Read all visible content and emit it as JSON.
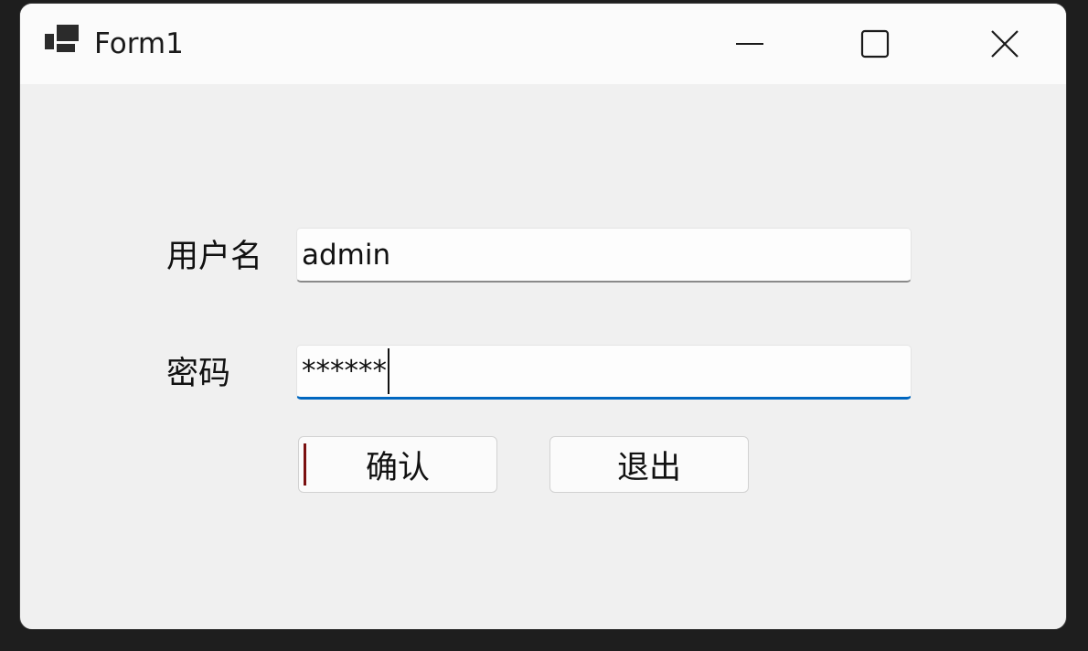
{
  "window": {
    "title": "Form1",
    "icons": {
      "app": "app-window-icon",
      "minimize": "minimize-icon",
      "maximize": "maximize-icon",
      "close": "close-icon"
    }
  },
  "form": {
    "username_label": "用户名",
    "username_value": "admin",
    "password_label": "密码",
    "password_masked": "******",
    "confirm_label": "确认",
    "exit_label": "退出"
  },
  "colors": {
    "focus_underline": "#0067c0",
    "focus_indicator": "#7a1010",
    "client_background": "#f0f0f0",
    "titlebar_background": "#fbfbfb"
  }
}
